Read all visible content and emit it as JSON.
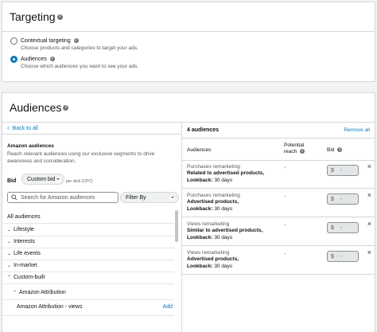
{
  "targeting": {
    "title": "Targeting",
    "info_glyph": "i",
    "options": [
      {
        "label": "Contextual targeting",
        "desc": "Choose products and categories to target your ads.",
        "selected": false
      },
      {
        "label": "Audiences",
        "desc": "Choose which audiences you want to see your ads.",
        "selected": true
      }
    ]
  },
  "audiences": {
    "title": "Audiences",
    "back_label": "Back to all",
    "section_title": "Amazon audiences",
    "section_desc": "Reach relevant audiences using our exclusive segments to drive awareness and consideration.",
    "bid_label": "Bid",
    "bid_select": "Custom bid",
    "bid_note": "per click (CPC)",
    "search_placeholder": "Search for Amazon audiences",
    "filter_label": "Filter By",
    "all_label": "All audiences",
    "categories": [
      {
        "label": "Lifestyle",
        "expanded": false
      },
      {
        "label": "Interests",
        "expanded": false
      },
      {
        "label": "Life events",
        "expanded": false
      },
      {
        "label": "In-market",
        "expanded": false
      },
      {
        "label": "Custom-built",
        "expanded": true
      }
    ],
    "subcategory": "Amazon Attribution",
    "subitem": {
      "label": "Amazon Attribution - views",
      "action": "Add"
    }
  },
  "selected": {
    "count_label": "4 audiences",
    "remove_all": "Remove all",
    "col_audiences": "Audiences",
    "col_reach_line1": "Potential",
    "col_reach_line2": "reach",
    "col_bid": "Bid",
    "rows": [
      {
        "type": "Purchases remarketing",
        "target": "Related to advertised products,",
        "lookback_label": "Lookback:",
        "lookback_value": " 30 days",
        "reach": "-",
        "bid_prefix": "$",
        "bid": "-"
      },
      {
        "type": "Purchases remarketing",
        "target": "Advertised products,",
        "lookback_label": "Lookback:",
        "lookback_value": " 30 days",
        "reach": "-",
        "bid_prefix": "$",
        "bid": "-"
      },
      {
        "type": "Views remarketing",
        "target": "Similar to advertised products,",
        "lookback_label": "Lookback:",
        "lookback_value": " 30 days",
        "reach": "-",
        "bid_prefix": "$",
        "bid": "-"
      },
      {
        "type": "Views remarketing",
        "target": "Advertised products,",
        "lookback_label": "Lookback:",
        "lookback_value": " 30 days",
        "reach": "-",
        "bid_prefix": "$",
        "bid": "-"
      }
    ]
  },
  "icons": {
    "info": "info-icon",
    "back": "chevron-left-icon",
    "search": "search-icon",
    "close": "close-icon",
    "expand": "chevron-down-icon",
    "collapse": "chevron-up-icon"
  },
  "colors": {
    "link": "#0a7ab8",
    "radio_selected": "#0a7ab8",
    "border": "#d5d9d9"
  }
}
